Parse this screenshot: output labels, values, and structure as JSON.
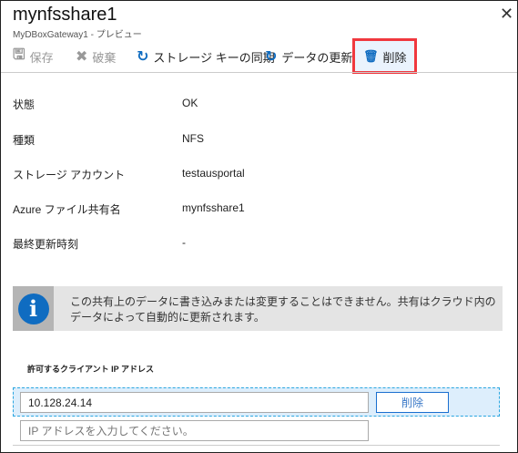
{
  "header": {
    "title": "mynfsshare1",
    "subtitle": "MyDBoxGateway1 - プレビュー"
  },
  "toolbar": {
    "save": "保存",
    "discard": "破棄",
    "sync_keys": "ストレージ キーの同期",
    "refresh": "データの更新",
    "delete": "削除"
  },
  "properties": [
    {
      "label": "状態",
      "value": "OK"
    },
    {
      "label": "種類",
      "value": "NFS"
    },
    {
      "label": "ストレージ アカウント",
      "value": "testausportal"
    },
    {
      "label": "Azure ファイル共有名",
      "value": "mynfsshare1"
    },
    {
      "label": "最終更新時刻",
      "value": "-"
    }
  ],
  "info": {
    "text": "この共有上のデータに書き込みまたは変更することはできません。共有はクラウド内のデータによって自動的に更新されます。"
  },
  "ip_section": {
    "label": "許可するクライアント IP アドレス",
    "entries": [
      {
        "value": "10.128.24.14",
        "delete": "削除"
      }
    ],
    "placeholder": "IP アドレスを入力してください。"
  },
  "colors": {
    "accent": "#0f6cc1",
    "highlight": "#f0383e"
  }
}
